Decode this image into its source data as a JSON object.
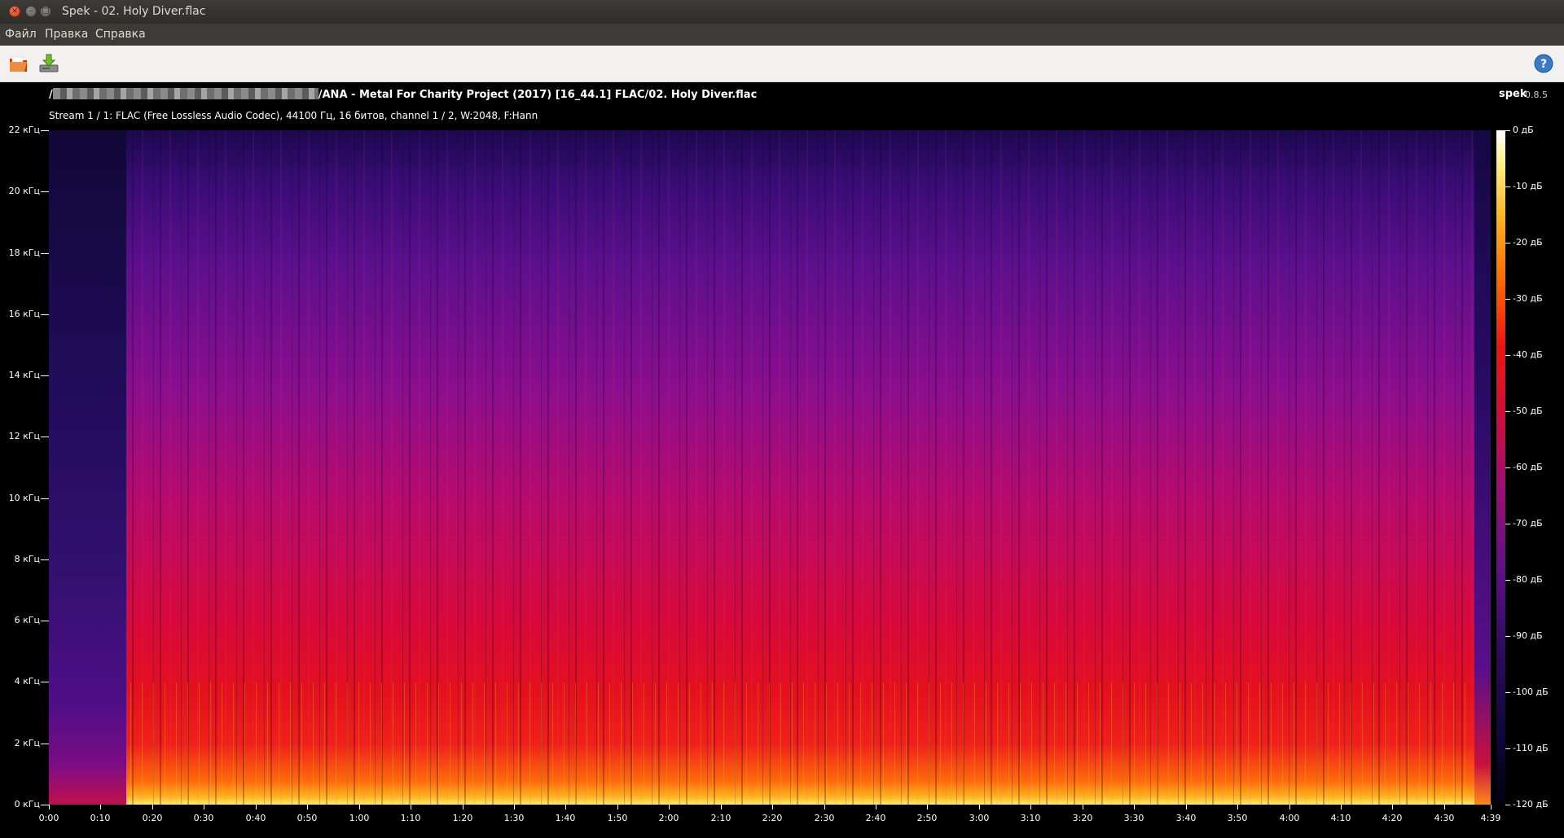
{
  "window": {
    "title": "Spek - 02. Holy Diver.flac",
    "buttons": {
      "close": "×",
      "minimize": "–",
      "maximize": "□"
    }
  },
  "menu": {
    "items": [
      "Файл",
      "Правка",
      "Справка"
    ]
  },
  "toolbar": {
    "open_icon": "folder-open-icon",
    "save_icon": "save-download-icon",
    "help_icon": "help-icon",
    "help_label": "?"
  },
  "spectrogram": {
    "file_path": "/ANA - Metal For Charity Project (2017) [16_44.1] FLAC/02. Holy Diver.flac",
    "path_prefix": "/",
    "app_name": "spek",
    "app_version": "0.8.5",
    "stream_info": "Stream 1 / 1: FLAC (Free Lossless Audio Codec), 44100 Гц, 16 битов, channel 1 / 2, W:2048, F:Hann"
  },
  "chart_data": {
    "type": "heatmap",
    "title": "",
    "y_axis": {
      "labels": [
        "0 кГц",
        "2 кГц",
        "4 кГц",
        "6 кГц",
        "8 кГц",
        "10 кГц",
        "12 кГц",
        "14 кГц",
        "16 кГц",
        "18 кГц",
        "20 кГц",
        "22 кГц"
      ],
      "values_khz": [
        0,
        2,
        4,
        6,
        8,
        10,
        12,
        14,
        16,
        18,
        20,
        22
      ],
      "range": [
        0,
        22
      ]
    },
    "x_axis": {
      "labels": [
        "0:00",
        "0:10",
        "0:20",
        "0:30",
        "0:40",
        "0:50",
        "1:00",
        "1:10",
        "1:20",
        "1:30",
        "1:40",
        "1:50",
        "2:00",
        "2:10",
        "2:20",
        "2:30",
        "2:40",
        "2:50",
        "3:00",
        "3:10",
        "3:20",
        "3:30",
        "3:40",
        "3:50",
        "4:00",
        "4:10",
        "4:20",
        "4:30",
        "4:39"
      ],
      "values_sec": [
        0,
        10,
        20,
        30,
        40,
        50,
        60,
        70,
        80,
        90,
        100,
        110,
        120,
        130,
        140,
        150,
        160,
        170,
        180,
        190,
        200,
        210,
        220,
        230,
        240,
        250,
        260,
        270,
        279
      ],
      "range": [
        0,
        279
      ]
    },
    "color_scale": {
      "labels": [
        "0 дБ",
        "-10 дБ",
        "-20 дБ",
        "-30 дБ",
        "-40 дБ",
        "-50 дБ",
        "-60 дБ",
        "-70 дБ",
        "-80 дБ",
        "-90 дБ",
        "-100 дБ",
        "-110 дБ",
        "-120 дБ"
      ],
      "values_db": [
        0,
        -10,
        -20,
        -30,
        -40,
        -50,
        -60,
        -70,
        -80,
        -90,
        -100,
        -110,
        -120
      ],
      "range": [
        -120,
        0
      ]
    }
  }
}
